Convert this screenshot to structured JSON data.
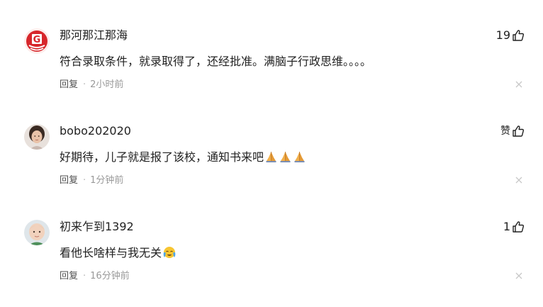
{
  "comments": [
    {
      "username": "那河那江那海",
      "content": "符合录取条件，就录取得了，还经批准。满脑子行政思维。。。。",
      "reply_label": "回复",
      "separator": "·",
      "time": "2小时前",
      "likes": "19",
      "avatar_icon": "red-logo-avatar",
      "emojis": []
    },
    {
      "username": "bobo202020",
      "content": "好期待，儿子就是报了该校，通知书来吧",
      "reply_label": "回复",
      "separator": "·",
      "time": "1分钟前",
      "likes": "赞",
      "avatar_icon": "woman-portrait-avatar",
      "emojis": [
        "folded-hands-emoji",
        "folded-hands-emoji",
        "folded-hands-emoji"
      ]
    },
    {
      "username": "初来乍到1392",
      "content": "看他长啥样与我无关",
      "reply_label": "回复",
      "separator": "·",
      "time": "16分钟前",
      "likes": "1",
      "avatar_icon": "baby-portrait-avatar",
      "emojis": [
        "crying-face-emoji"
      ]
    }
  ],
  "colors": {
    "text": "#222222",
    "reply": "#505050",
    "muted": "#999999",
    "close": "#c8c8c8",
    "avatar_red": "#d7262b"
  }
}
